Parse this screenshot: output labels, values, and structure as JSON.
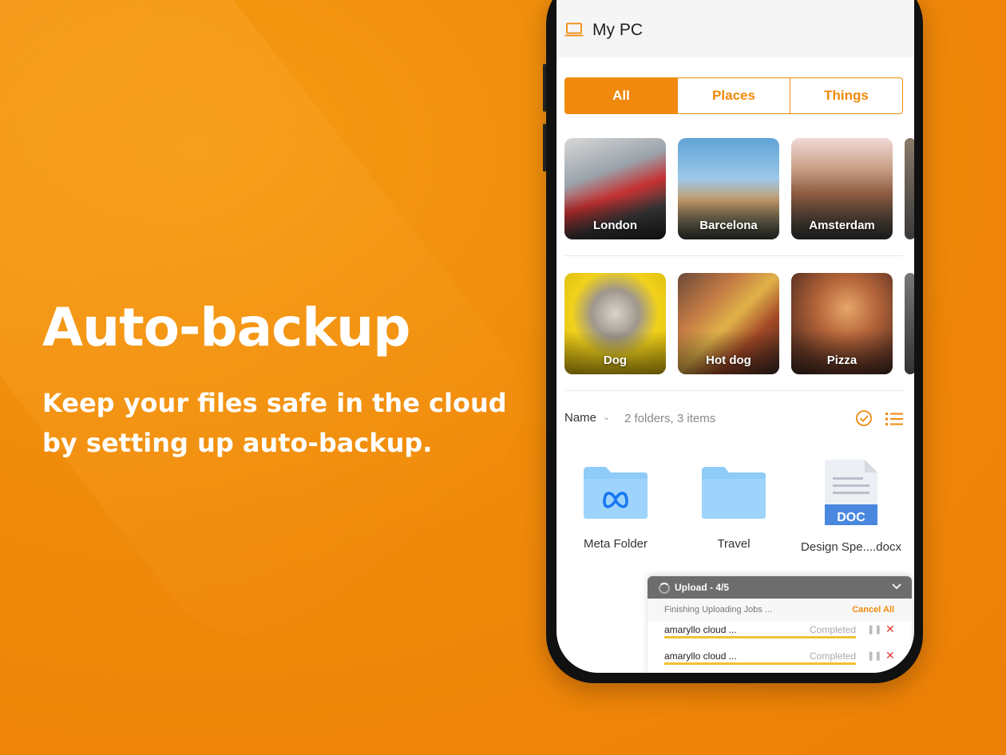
{
  "promo": {
    "headline": "Auto-backup",
    "subline": "Keep your files safe in the cloud by setting up auto-backup."
  },
  "app": {
    "title": "My PC",
    "tabs": [
      "All",
      "Places",
      "Things"
    ],
    "active_tab": "All",
    "places": [
      "London",
      "Barcelona",
      "Amsterdam"
    ],
    "things": [
      "Dog",
      "Hot dog",
      "Pizza"
    ],
    "sort_label": "Name",
    "summary": "2 folders, 3 items",
    "files": [
      {
        "name": "Meta Folder",
        "icon": "meta-folder-icon"
      },
      {
        "name": "Travel",
        "icon": "folder-icon"
      },
      {
        "name": "Design Spe....docx",
        "icon": "doc-file-icon",
        "badge": "DOC"
      }
    ]
  },
  "upload": {
    "title": "Upload - 4/5",
    "status": "Finishing Uploading Jobs ...",
    "cancel_all": "Cancel All",
    "jobs": [
      {
        "name": "amaryllo cloud ...",
        "status": "Completed",
        "progress": 1.0
      },
      {
        "name": "amaryllo cloud ...",
        "status": "Completed",
        "progress": 1.0
      }
    ]
  },
  "colors": {
    "accent": "#f0890c",
    "background": "#ef860a",
    "folder": "#8ecbf8",
    "doc_badge": "#4a88e0",
    "progress": "#f1c232",
    "cancel_x": "#e53935"
  }
}
